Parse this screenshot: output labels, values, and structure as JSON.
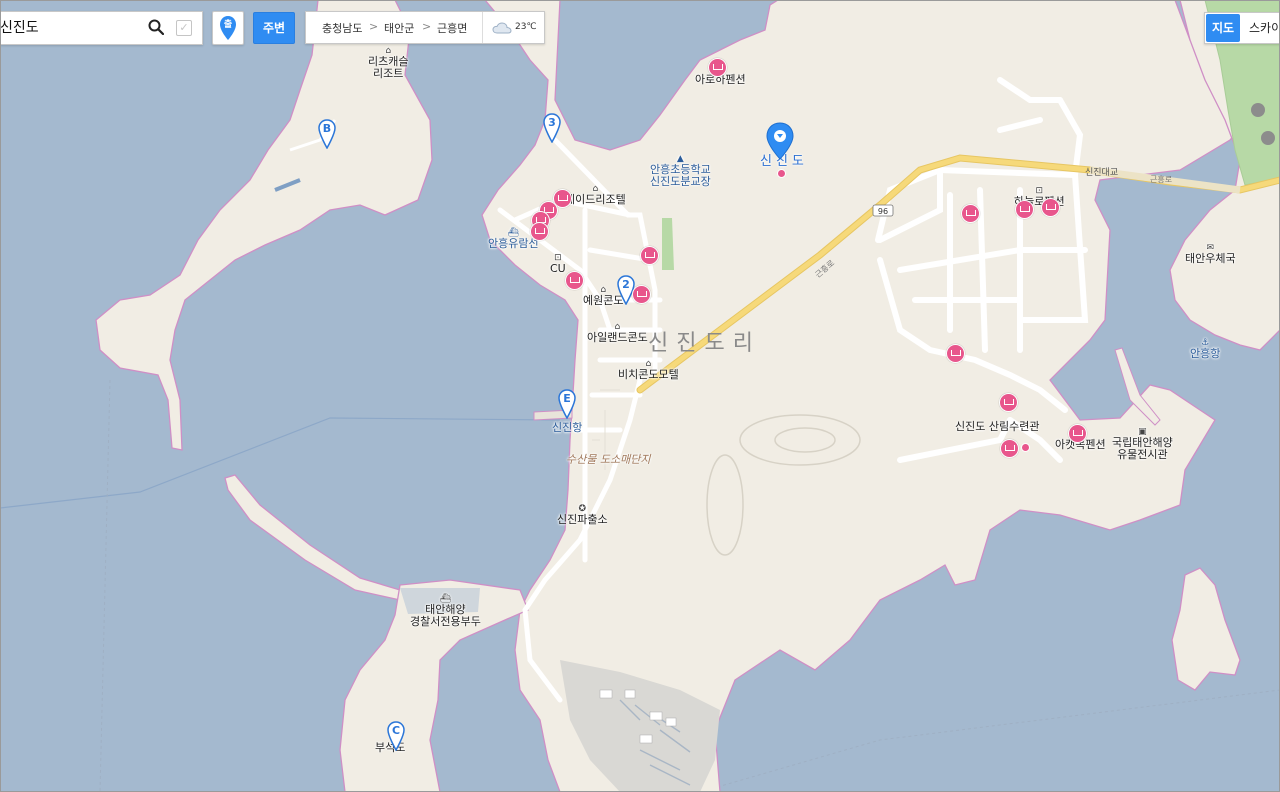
{
  "search": {
    "query": "신진도",
    "placeholder": ""
  },
  "controls": {
    "nearby_label": "주변",
    "my_location_label": "출",
    "map_type_map": "지도",
    "map_type_sky": "스카이"
  },
  "breadcrumb": {
    "items": [
      "충청남도",
      "태안군",
      "근흥면"
    ],
    "weather_temp": "23℃"
  },
  "colors": {
    "water": "#a4b9cf",
    "land": "#f1ede4",
    "coast": "#cf8fc6",
    "accent": "#2f8cf2",
    "hotel": "#e8568c",
    "yellow_road": "#f6d97a"
  },
  "map": {
    "district_label": "신진도리",
    "main_marker_label": "신진도",
    "road_number": "96",
    "road_name_1": "근흥로",
    "road_name_2": "근흥로",
    "bridge_label": "신진대교",
    "markers": [
      "B",
      "3",
      "2",
      "E",
      "C"
    ],
    "places": {
      "resort": "리츠캐슬\n리조트",
      "arohapension": "아로하펜션",
      "school": "안흥초등학교\n신진도분교장",
      "daydream": "데이드리조텔",
      "ferry_ahnheung": "안흥유람선",
      "cu": "CU",
      "yewon": "예원콘도",
      "island_condo": "아일랜드콘도",
      "beach_motel": "비치콘도모텔",
      "sinjin_port": "신진항",
      "fish_complex": "수산물\n도소매단지",
      "police": "신진파출소",
      "coast_guard": "태안해양\n경찰서전용부두",
      "buseok": "부석도",
      "forest_hall": "신진도\n산림수련관",
      "yacht_pension": "아캣목펜션",
      "museum": "국립태안해양\n유물전시관",
      "post_office": "태안우체국",
      "ahnheung_port": "안흥항",
      "haneul_pension": "하늘로펜션"
    }
  }
}
